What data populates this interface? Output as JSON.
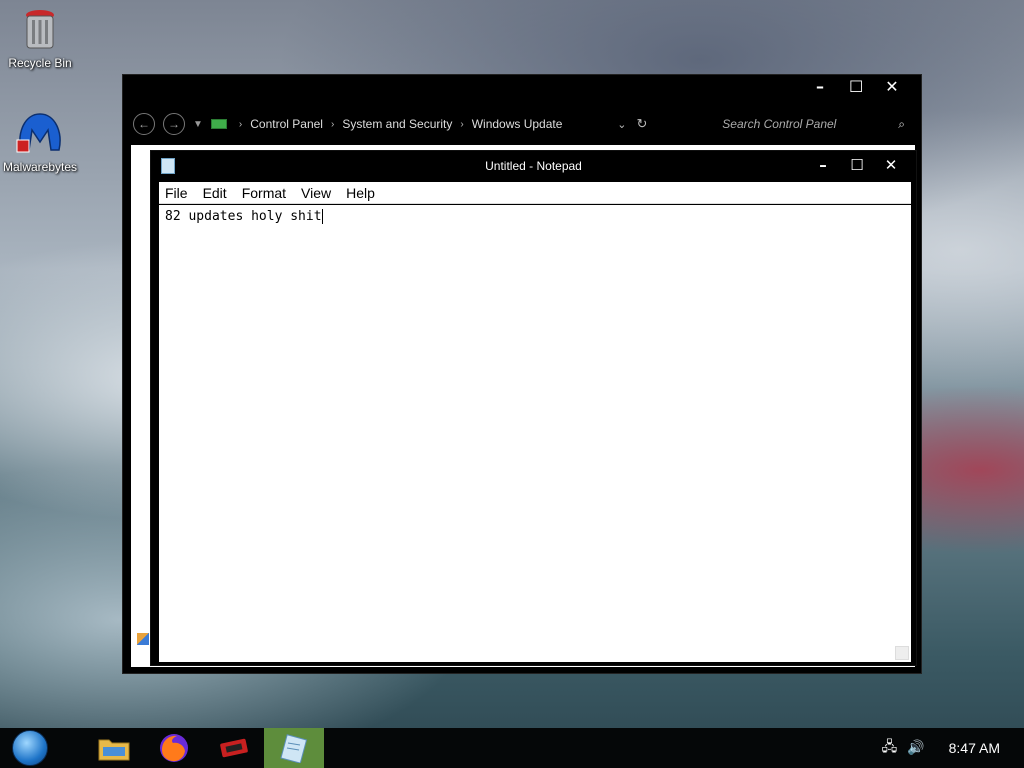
{
  "desktop": {
    "icons": [
      {
        "label": "Recycle Bin"
      },
      {
        "label": "Malwarebytes"
      }
    ]
  },
  "explorer": {
    "breadcrumbs": [
      "Control Panel",
      "System and Security",
      "Windows Update"
    ],
    "search_placeholder": "Search Control Panel"
  },
  "notepad": {
    "title": "Untitled - Notepad",
    "menu": [
      "File",
      "Edit",
      "Format",
      "View",
      "Help"
    ],
    "content": "82 updates holy shit"
  },
  "taskbar": {
    "clock": "8:47 AM"
  },
  "colors": {
    "taskbar_bg": "#050708",
    "active_task": "#5e8d3c",
    "window_frame": "#000000"
  }
}
